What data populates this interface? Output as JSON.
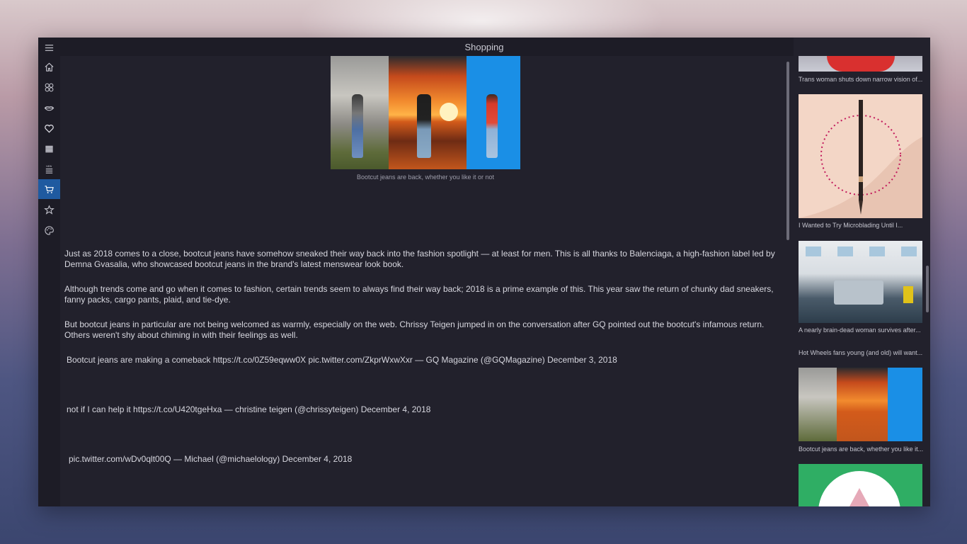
{
  "window": {
    "title": "Shopping"
  },
  "sidebar": {
    "items": [
      {
        "icon": "hamburger-menu-icon"
      },
      {
        "icon": "home-icon"
      },
      {
        "icon": "apps-grid-icon"
      },
      {
        "icon": "lips-icon"
      },
      {
        "icon": "heart-icon"
      },
      {
        "icon": "book-icon"
      },
      {
        "icon": "new-list-icon",
        "label": "NEW"
      },
      {
        "icon": "shopping-cart-icon",
        "active": true
      },
      {
        "icon": "star-icon"
      },
      {
        "icon": "palette-icon"
      }
    ],
    "active_color": "#1f5aa0"
  },
  "article": {
    "image_caption": "Bootcut jeans are back, whether you like it or not",
    "paragraphs": [
      "Just as 2018 comes to a close, bootcut jeans have somehow sneaked their way back into the fashion spotlight — at least for men. This is all thanks to Balenciaga, a high-fashion label led by Demna Gvasalia, who showcased bootcut jeans in the brand's latest menswear look book.",
      "Although trends come and go when it comes to fashion, certain trends seem to always find their way back; 2018 is a prime example of this. This year saw the return of chunky dad sneakers, fanny packs, cargo pants, plaid, and tie-dye.",
      "But bootcut jeans in particular are not being welcomed as warmly, especially on the web. Chrissy Teigen jumped in on the conversation after GQ pointed out the bootcut's infamous return. Others weren't shy about chiming in with their feelings as well."
    ],
    "tweets": [
      "Bootcut jeans are making a comeback https://t.co/0Z59eqww0X pic.twitter.com/ZkprWxwXxr — GQ Magazine (@GQMagazine) December 3, 2018",
      "not if I can help it https://t.co/U420tgeHxa — christine teigen (@chrissyteigen) December 4, 2018",
      "pic.twitter.com/wDv0qlt00Q — Michael (@michaelology) December 4, 2018"
    ]
  },
  "related": [
    {
      "title": "Trans woman shuts down narrow vision of..."
    },
    {
      "title": "I Wanted to Try Microblading Until I..."
    },
    {
      "title": "A nearly brain-dead woman survives after..."
    },
    {
      "title": "Hot Wheels fans young (and old) will want..."
    },
    {
      "title": "Bootcut jeans are back, whether you like it..."
    }
  ]
}
